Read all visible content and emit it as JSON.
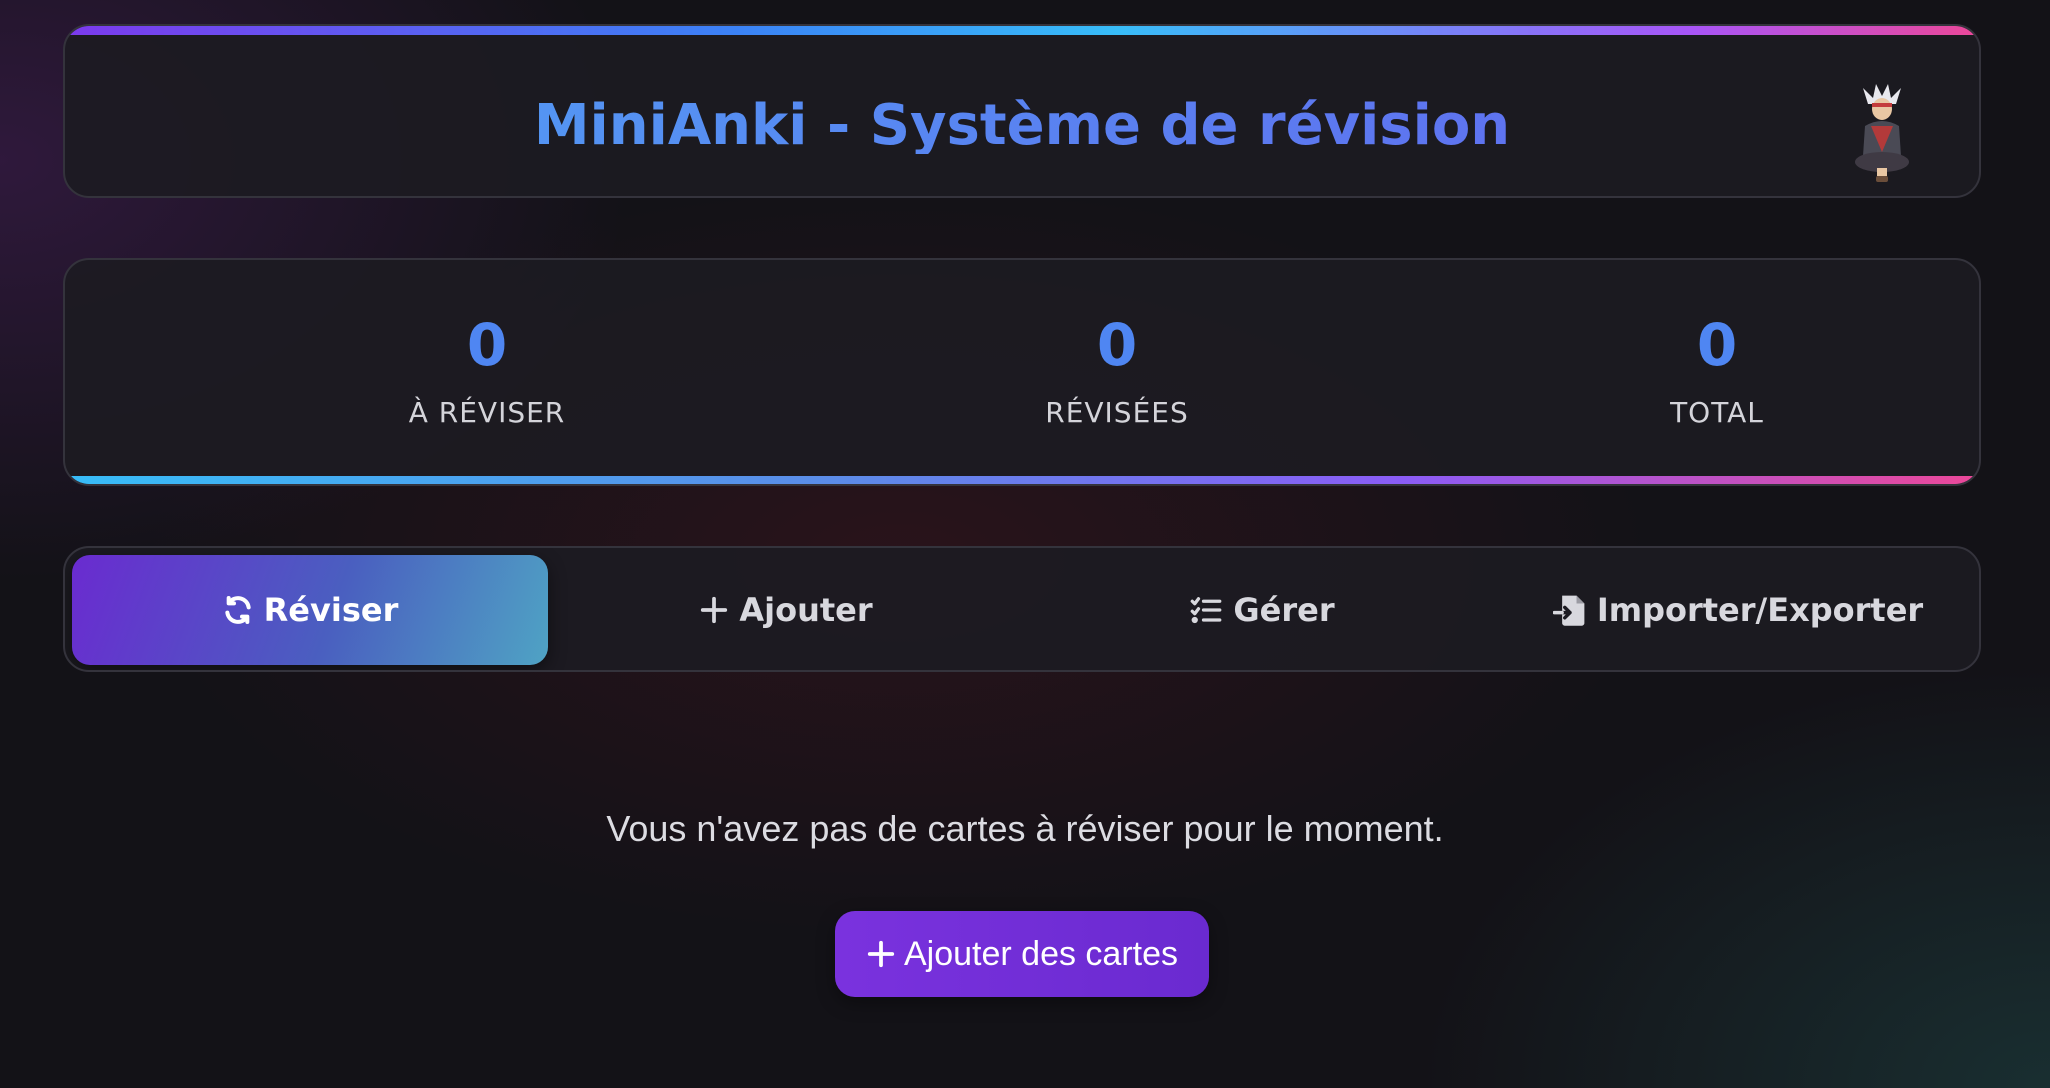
{
  "header": {
    "title": "MiniAnki - Système de révision",
    "avatar_icon": "meditating-character-avatar"
  },
  "stats": [
    {
      "value": "0",
      "label": "À RÉVISER"
    },
    {
      "value": "0",
      "label": "RÉVISÉES"
    },
    {
      "value": "0",
      "label": "TOTAL"
    }
  ],
  "tabs": [
    {
      "label": "Réviser",
      "icon": "refresh-icon",
      "active": true
    },
    {
      "label": "Ajouter",
      "icon": "plus-icon",
      "active": false
    },
    {
      "label": "Gérer",
      "icon": "checklist-icon",
      "active": false
    },
    {
      "label": "Importer/Exporter",
      "icon": "file-import-icon",
      "active": false
    }
  ],
  "empty_state": {
    "message": "Vous n'avez pas de cartes à réviser pour le moment.",
    "button_label": "Ajouter des cartes",
    "button_icon": "plus-icon"
  },
  "colors": {
    "accent_blue": "#4f86f2",
    "accent_purple": "#7a32de",
    "background": "#131217"
  }
}
